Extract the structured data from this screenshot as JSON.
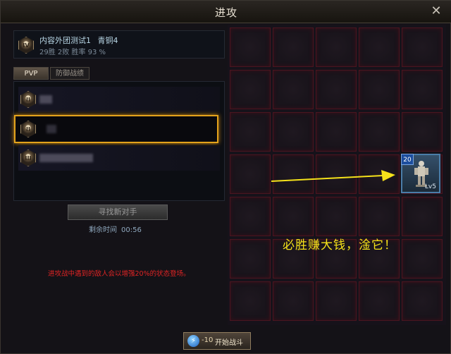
{
  "window": {
    "title": "进攻",
    "close_label": "✕"
  },
  "profile": {
    "rank": "IV",
    "name": "内容外团测试1",
    "guild": "青铜4",
    "stats": "29胜 2败 胜率 93 %"
  },
  "tabs": [
    {
      "label": "PVP",
      "active": true
    },
    {
      "label": "防御战绩",
      "active": false
    }
  ],
  "opponents": [
    {
      "rank": "II",
      "selected": false
    },
    {
      "rank": "II",
      "selected": true
    },
    {
      "rank": "III",
      "selected": false
    }
  ],
  "find_button": {
    "label": "寻找新对手"
  },
  "timer": {
    "label": "剩余时间",
    "value": "00:56"
  },
  "notice": "进攻战中遇到的敌人会以增强20%的状态登场。",
  "unit": {
    "level_badge": "20",
    "lv_label": "Lv5"
  },
  "caption": "必胜赚大钱，淦它！",
  "start_button": {
    "cost": "-10",
    "label": "开始战斗"
  },
  "colors": {
    "accent": "#e3a21b",
    "grid_border": "#4a1520",
    "caption": "#f5e21a",
    "notice": "#e02424"
  }
}
